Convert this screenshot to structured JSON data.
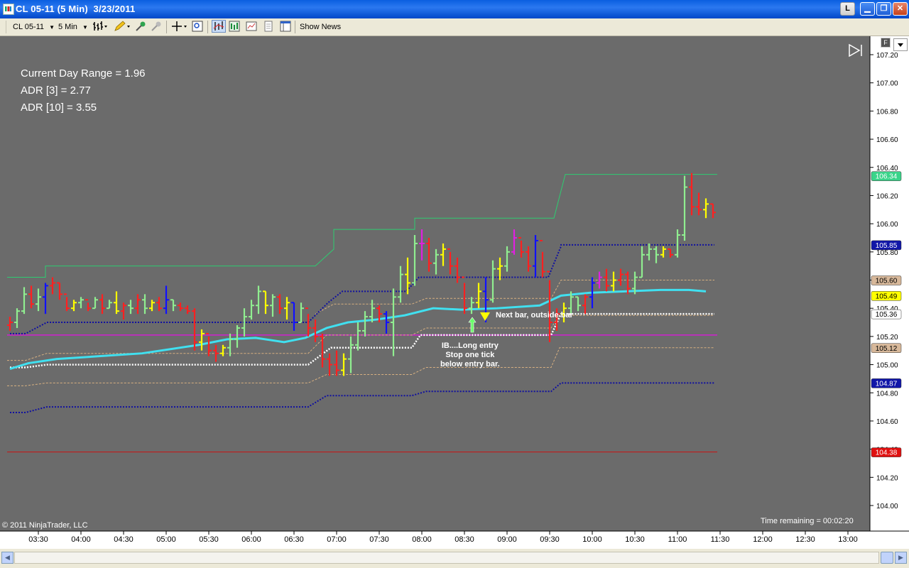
{
  "window": {
    "title": "CL 05-11 (5 Min)  3/23/2011",
    "l_button": "L"
  },
  "toolbar": {
    "instrument": "CL 05-11",
    "interval": "5 Min",
    "show_news": "Show News"
  },
  "chart": {
    "info_lines": [
      "Current Day Range = 1.96",
      "ADR [3] = 2.77",
      "ADR [10] = 3.55"
    ],
    "annotation_right": "Next bar, outside bar",
    "annotation_entry": [
      "IB....Long entry",
      "Stop one tick",
      "below entry bar."
    ],
    "copyright": "© 2011 NinjaTrader, LLC",
    "time_remaining": "Time remaining = 00:02:20",
    "f_tag": "F",
    "price_ticks": [
      "107.20",
      "107.00",
      "106.80",
      "106.60",
      "106.40",
      "106.20",
      "106.00",
      "105.80",
      "105.60",
      "105.40",
      "105.20",
      "105.00",
      "104.80",
      "104.60",
      "104.40",
      "104.20",
      "104.00"
    ],
    "time_ticks": [
      "03:30",
      "04:00",
      "04:30",
      "05:00",
      "05:30",
      "06:00",
      "06:30",
      "07:00",
      "07:30",
      "08:00",
      "08:30",
      "09:00",
      "09:30",
      "10:00",
      "10:30",
      "11:00",
      "11:30",
      "12:00",
      "12:30",
      "13:00"
    ],
    "price_markers": [
      {
        "label": "106.34",
        "bg": "#3ad48a",
        "fg": "#ffffff"
      },
      {
        "label": "105.85",
        "bg": "#1016a8",
        "fg": "#ffffff"
      },
      {
        "label": "105.60",
        "bg": "#d7b89a",
        "fg": "#000000"
      },
      {
        "label": "105.49",
        "bg": "#ffff00",
        "fg": "#000000"
      },
      {
        "label": "105.36",
        "bg": "#ffffff",
        "fg": "#000000"
      },
      {
        "label": "105.12",
        "bg": "#d7b89a",
        "fg": "#000000"
      },
      {
        "label": "104.87",
        "bg": "#1016a8",
        "fg": "#ffffff"
      },
      {
        "label": "104.38",
        "bg": "#e01010",
        "fg": "#ffffff"
      }
    ]
  },
  "colors": {
    "background": "#6b6b6b",
    "bar_up": "#90ee90",
    "bar_down": "#ff2020",
    "bar_inside": "#ffff00",
    "bar_outside": "#1010ff",
    "bar_magenta": "#e020e0",
    "ema": "#40e0f0",
    "pivot_dots": "#1010a0",
    "mid_dots": "#ffffff",
    "range_line": "#d8b080",
    "day_high_line": "#2ecc71",
    "day_low_line": "#cc1111",
    "magenta_line": "#d020d0"
  }
}
